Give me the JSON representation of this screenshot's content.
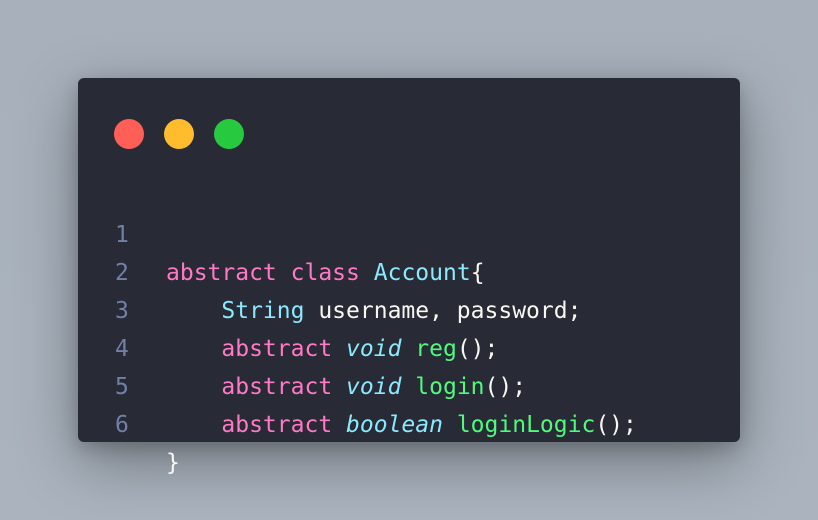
{
  "window": {
    "traffic_lights": [
      {
        "name": "close",
        "color": "#ff5f56"
      },
      {
        "name": "minimize",
        "color": "#ffbd2e"
      },
      {
        "name": "maximize",
        "color": "#27c93f"
      }
    ]
  },
  "code": {
    "lines": [
      {
        "number": "1",
        "tokens": [
          {
            "text": "abstract",
            "kind": "keyword"
          },
          {
            "text": " ",
            "kind": "plain"
          },
          {
            "text": "class",
            "kind": "keyword"
          },
          {
            "text": " ",
            "kind": "plain"
          },
          {
            "text": "Account",
            "kind": "type"
          },
          {
            "text": "{",
            "kind": "plain"
          }
        ]
      },
      {
        "number": "2",
        "tokens": [
          {
            "text": "    ",
            "kind": "plain"
          },
          {
            "text": "String",
            "kind": "type"
          },
          {
            "text": " username, password;",
            "kind": "plain"
          }
        ]
      },
      {
        "number": "3",
        "tokens": [
          {
            "text": "    ",
            "kind": "plain"
          },
          {
            "text": "abstract",
            "kind": "keyword"
          },
          {
            "text": " ",
            "kind": "plain"
          },
          {
            "text": "void",
            "kind": "type-italic"
          },
          {
            "text": " ",
            "kind": "plain"
          },
          {
            "text": "reg",
            "kind": "function"
          },
          {
            "text": "();",
            "kind": "plain"
          }
        ]
      },
      {
        "number": "4",
        "tokens": [
          {
            "text": "    ",
            "kind": "plain"
          },
          {
            "text": "abstract",
            "kind": "keyword"
          },
          {
            "text": " ",
            "kind": "plain"
          },
          {
            "text": "void",
            "kind": "type-italic"
          },
          {
            "text": " ",
            "kind": "plain"
          },
          {
            "text": "login",
            "kind": "function"
          },
          {
            "text": "();",
            "kind": "plain"
          }
        ]
      },
      {
        "number": "5",
        "tokens": [
          {
            "text": "    ",
            "kind": "plain"
          },
          {
            "text": "abstract",
            "kind": "keyword"
          },
          {
            "text": " ",
            "kind": "plain"
          },
          {
            "text": "boolean",
            "kind": "type-italic"
          },
          {
            "text": " ",
            "kind": "plain"
          },
          {
            "text": "loginLogic",
            "kind": "function"
          },
          {
            "text": "();",
            "kind": "plain"
          }
        ]
      },
      {
        "number": "6",
        "tokens": [
          {
            "text": "}",
            "kind": "plain"
          }
        ]
      }
    ]
  },
  "colors": {
    "background": "#282a36",
    "keyword": "#ff79c6",
    "type": "#8be9fd",
    "function": "#50fa7b",
    "plain": "#f8f8f2",
    "line_number": "#7280a8"
  }
}
